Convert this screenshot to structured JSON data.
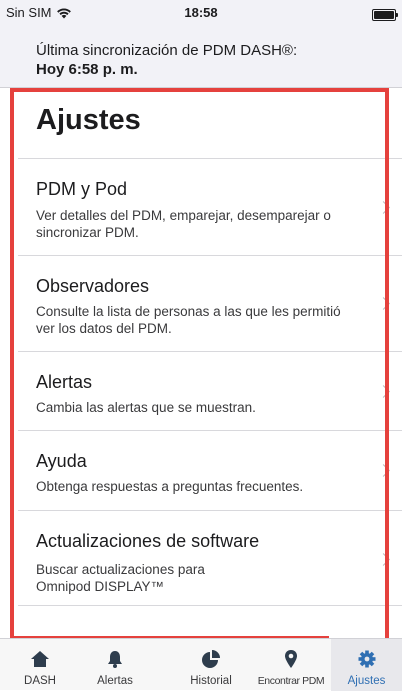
{
  "status_bar": {
    "carrier": "Sin SIM",
    "time": "18:58"
  },
  "sync": {
    "label": "Última sincronización de PDM DASH®:",
    "value": "Hoy 6:58 p. m."
  },
  "page": {
    "title": "Ajustes"
  },
  "settings_items": [
    {
      "title": "PDM y Pod",
      "description": "Ver detalles del PDM, emparejar, desemparejar o sincronizar PDM."
    },
    {
      "title": "Observadores",
      "description": "Consulte la lista de personas a las que les permitió ver los datos del PDM."
    },
    {
      "title": "Alertas",
      "description": "Cambia las alertas que se muestran."
    },
    {
      "title": "Ayuda",
      "description": "Obtenga respuestas a preguntas frecuentes."
    },
    {
      "title": "Actualizaciones de software",
      "description": "Buscar actualizaciones para Omnipod DISPLAY™"
    }
  ],
  "tabs": [
    {
      "label": "DASH",
      "icon": "home-icon"
    },
    {
      "label": "Alertas",
      "icon": "bell-icon"
    },
    {
      "label": "Historial",
      "icon": "pie-chart-icon"
    },
    {
      "label": "Encontrar PDM",
      "icon": "location-pin-icon"
    },
    {
      "label": "Ajustes",
      "icon": "gear-icon",
      "active": true
    }
  ],
  "colors": {
    "accent": "#2f6fb3",
    "highlight": "#e5413d",
    "icon_dark": "#2e3d4d"
  }
}
